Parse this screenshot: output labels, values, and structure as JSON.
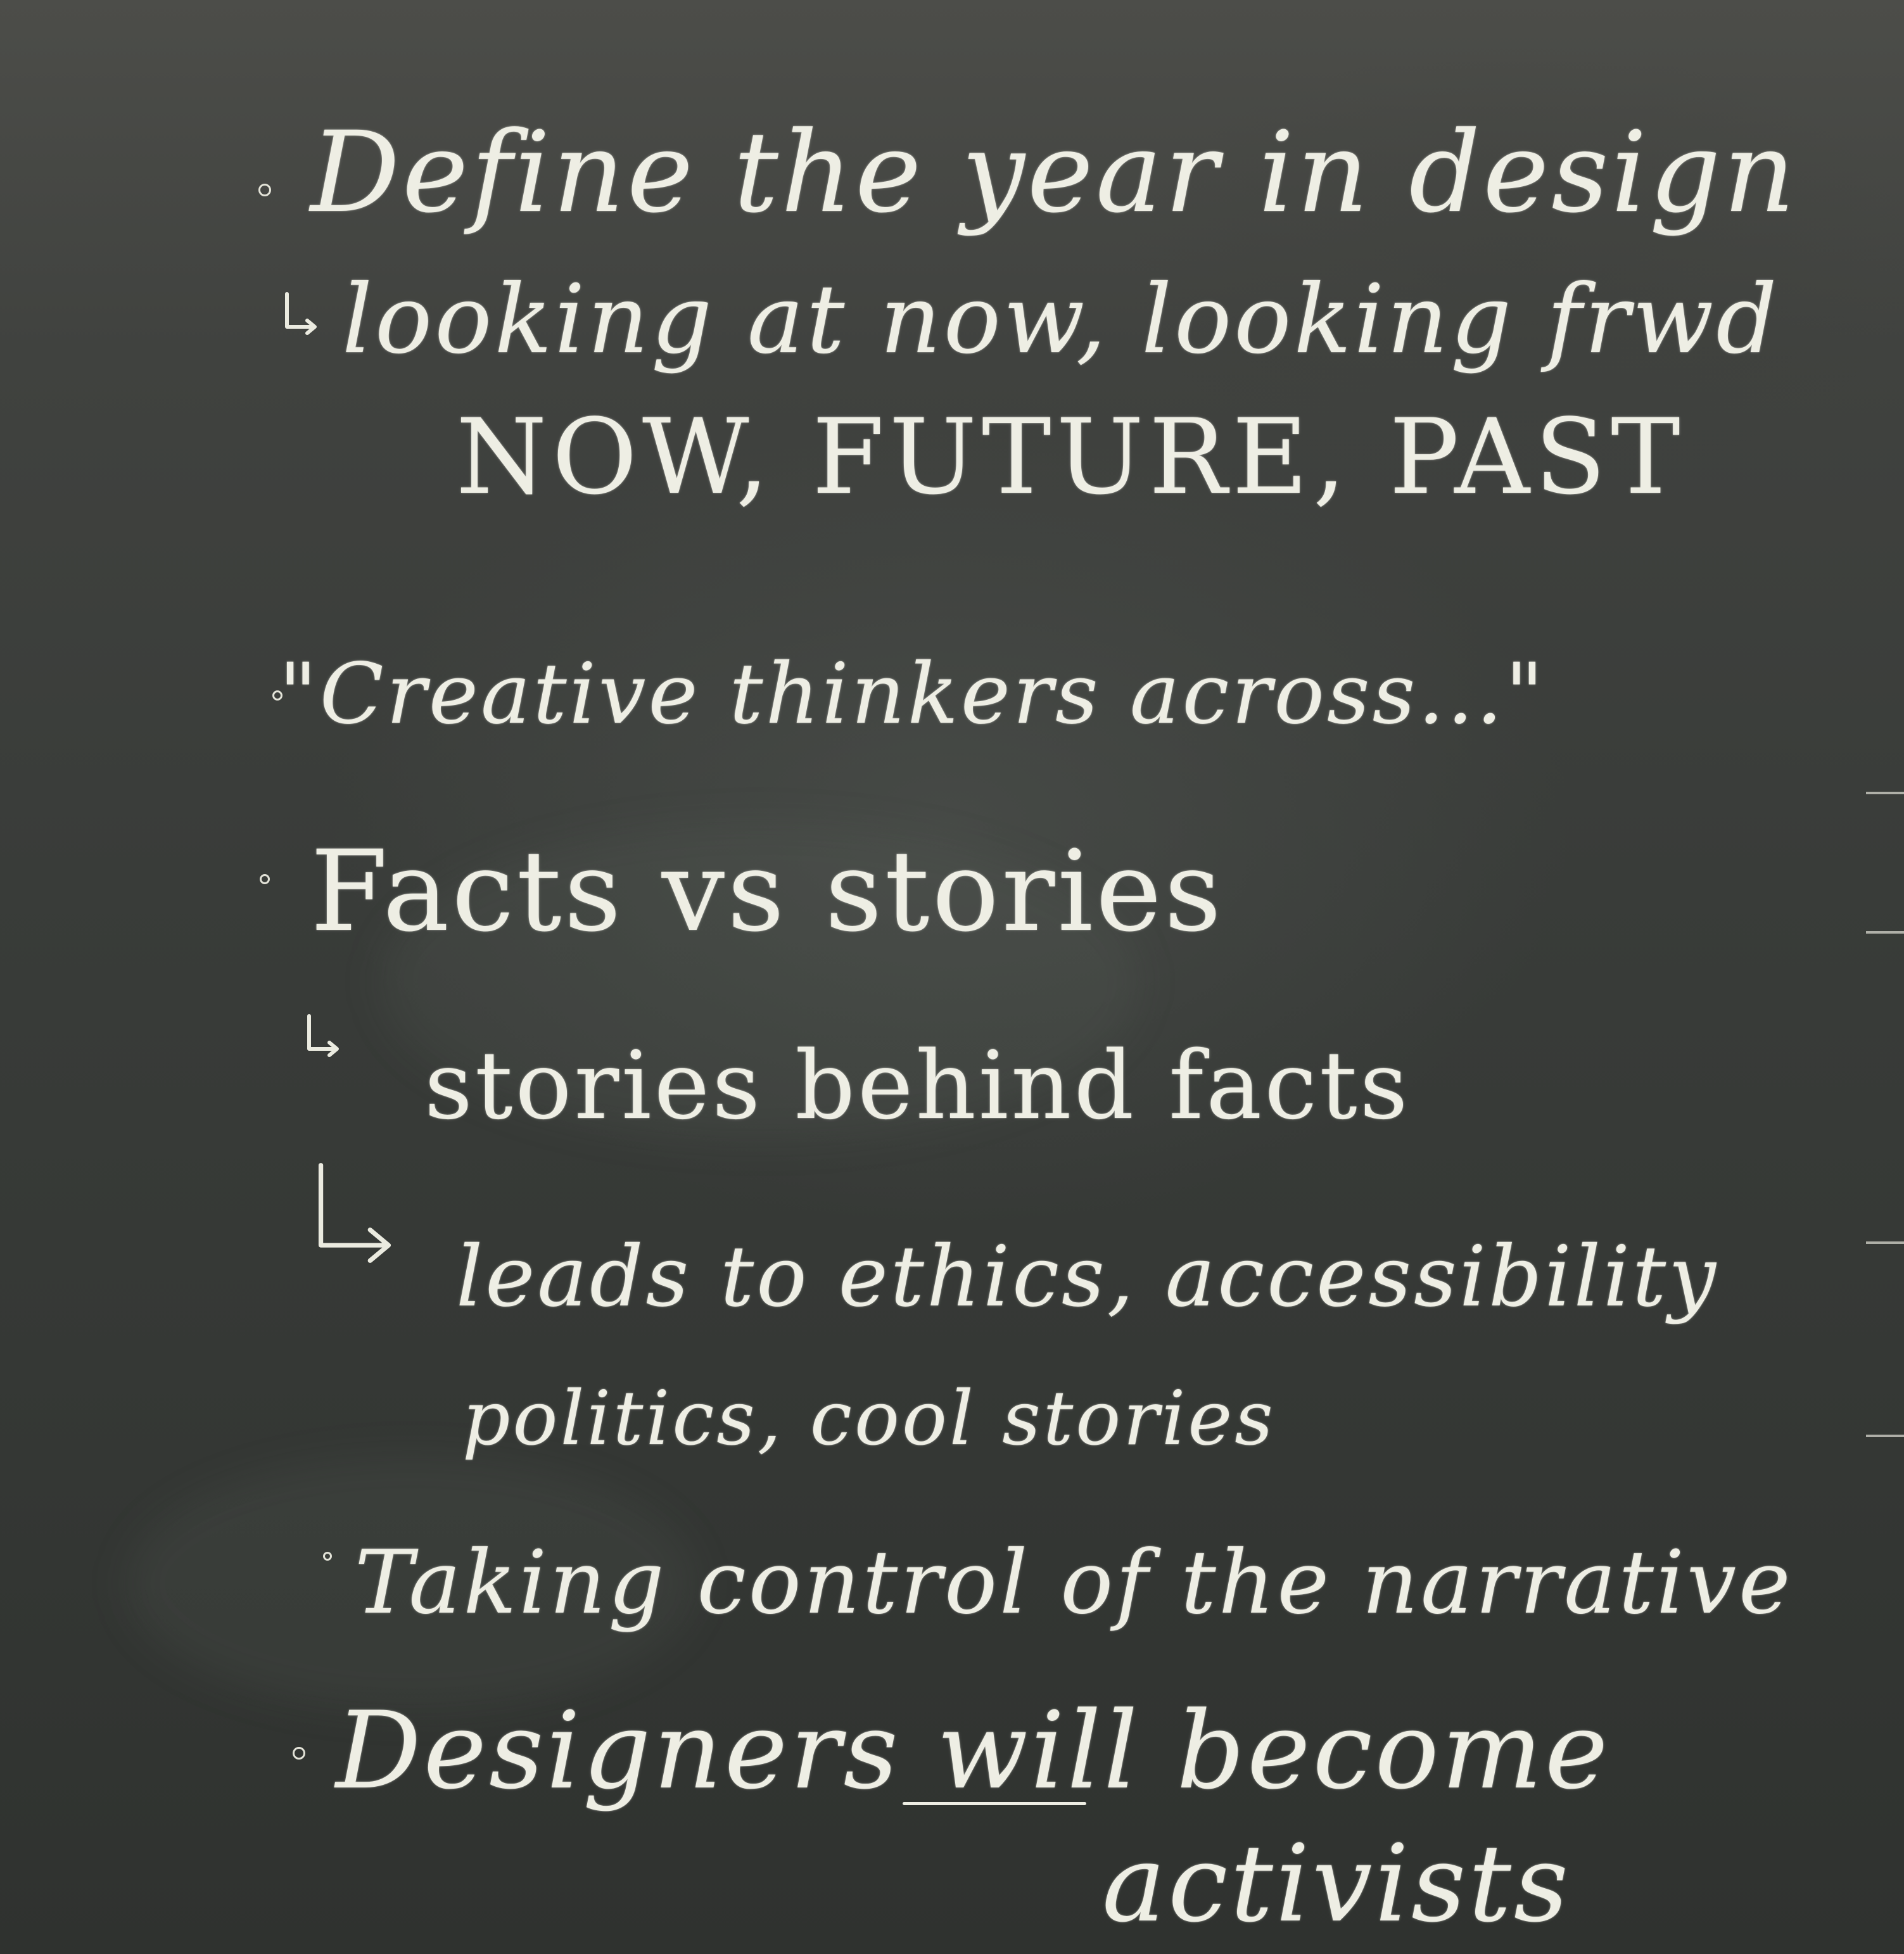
{
  "board": {
    "lines": [
      "Define the year in design",
      "looking at now, looking frwd",
      "NOW, FUTURE, PAST",
      "\"Creative thinkers across...\"",
      "Facts vs stories",
      "stories behind facts",
      "leads to ethics, accessibility",
      "politics, cool stories",
      "Taking control of the narrative",
      "Designers will become",
      "activists"
    ]
  }
}
